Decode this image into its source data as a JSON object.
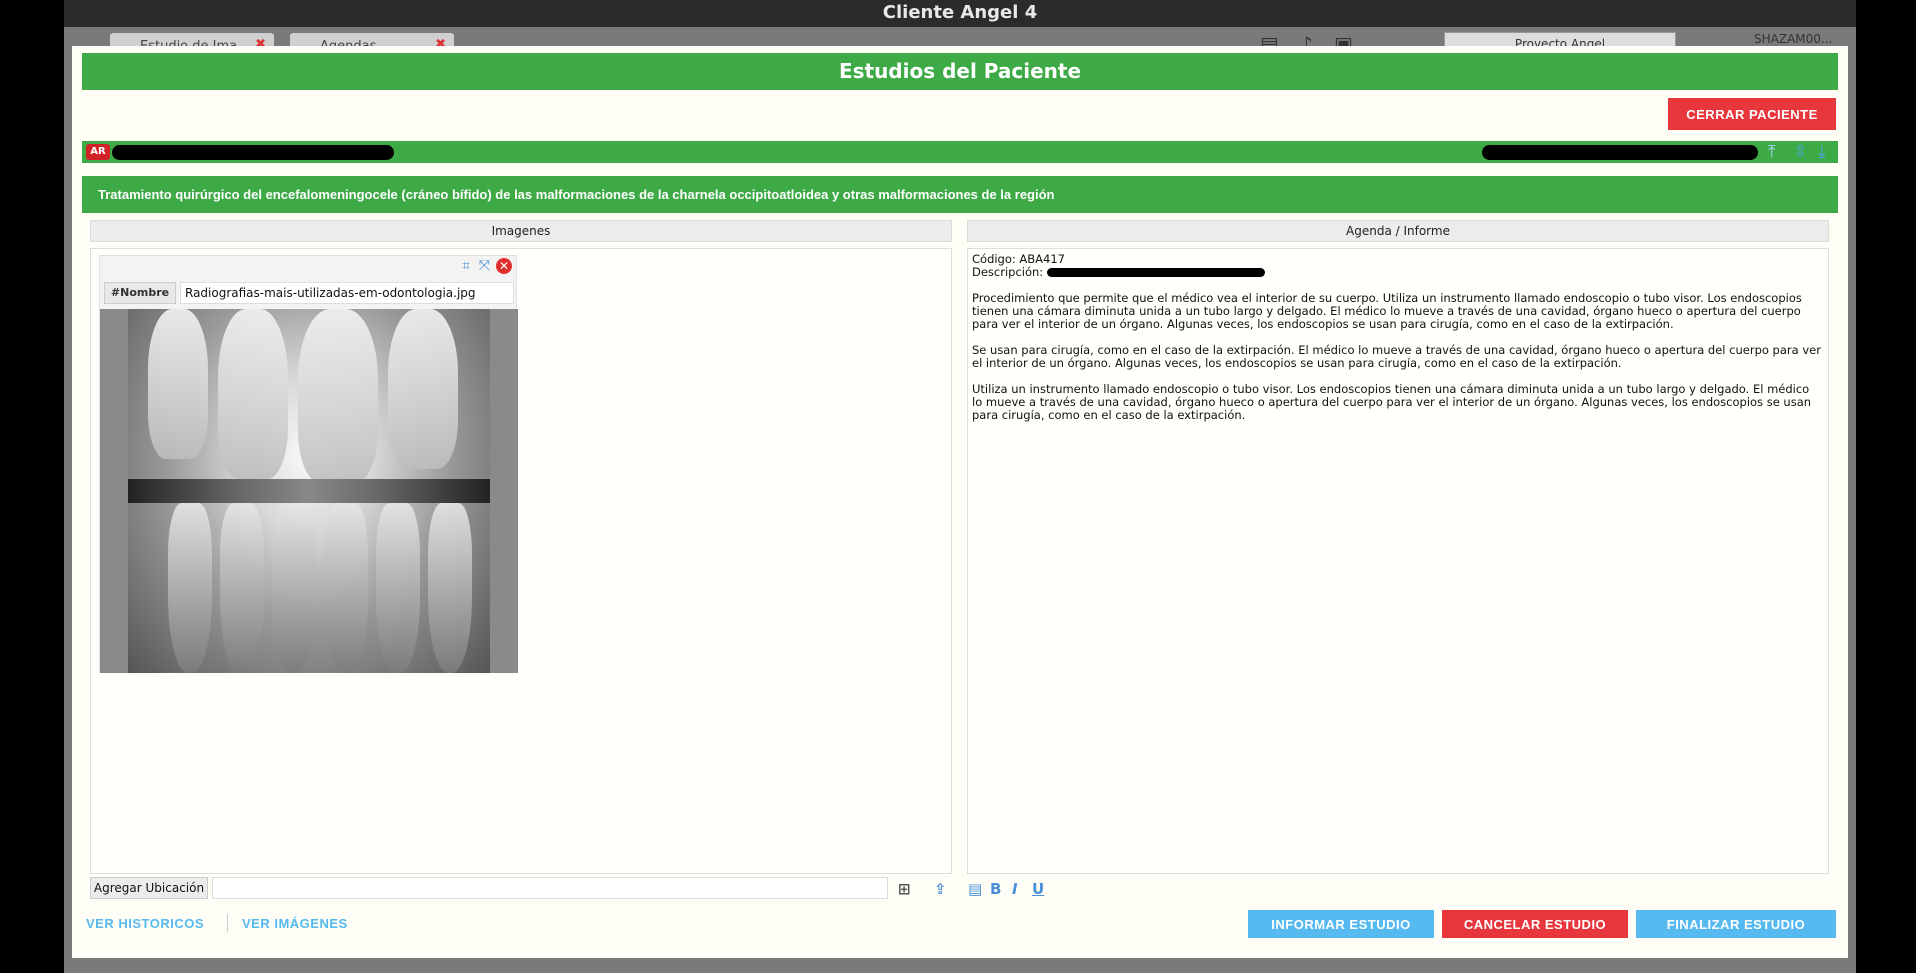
{
  "window": {
    "title": "Cliente Angel 4"
  },
  "background": {
    "tabs": [
      {
        "label": "Estudio de Ima..."
      },
      {
        "label": "Agendas"
      }
    ],
    "search_value": "Proyecto Angel",
    "user": "SHAZAM00..."
  },
  "modal": {
    "title": "Estudios del Paciente",
    "close_patient_label": "CERRAR PACIENTE",
    "patient_badge": "AR",
    "procedure": "Tratamiento quirúrgico del encefalomeningocele (cráneo bífido) de las malformaciones de la charnela occipitoatloidea y otras malformaciones de la región",
    "images_header": "Imagenes",
    "report_header": "Agenda / Informe",
    "image_card": {
      "name_label": "#Nombre",
      "name_value": "Radiografias-mais-utilizadas-em-odontologia.jpg"
    },
    "report": {
      "code_line": "Código: ABA417",
      "desc_label": "Descripción:",
      "paragraphs": [
        "Procedimiento que permite que el médico vea el interior de su cuerpo. Utiliza un instrumento llamado endoscopio o tubo visor. Los endoscopios tienen una cámara diminuta unida a un tubo largo y delgado. El médico lo mueve a través de una cavidad, órgano hueco o apertura del cuerpo para ver el interior de un órgano. Algunas veces, los endoscopios se usan para cirugía, como en el caso de la extirpación.",
        "Se usan para cirugía, como en el caso de la extirpación. El médico lo mueve a través de una cavidad, órgano hueco o apertura del cuerpo para ver el interior de un órgano. Algunas veces, los endoscopios se usan para cirugía, como en el caso de la extirpación.",
        "Utiliza un instrumento llamado endoscopio o tubo visor. Los endoscopios tienen una cámara diminuta unida a un tubo largo y delgado. El médico lo mueve a través de una cavidad, órgano hueco o apertura del cuerpo para ver el interior de un órgano. Algunas veces, los endoscopios se usan para cirugía, como en el caso de la extirpación."
      ]
    },
    "add_location_label": "Agregar Ubicación",
    "footer": {
      "link_historicos": "VER HISTORICOS",
      "link_imagenes": "VER IMÁGENES",
      "btn_informar": "INFORMAR ESTUDIO",
      "btn_cancelar": "CANCELAR ESTUDIO",
      "btn_finalizar": "FINALIZAR ESTUDIO"
    }
  },
  "colors": {
    "header_green": "#3daa45",
    "danger_red": "#e8363d",
    "action_blue": "#56b9f0"
  },
  "icons": [
    "crop-icon",
    "expand-icon",
    "close-icon",
    "add-icon",
    "upload-icon",
    "file-icon",
    "bold-icon",
    "italic-icon",
    "underline-icon",
    "sort-top-icon",
    "sort-middle-icon",
    "sort-bottom-icon"
  ]
}
